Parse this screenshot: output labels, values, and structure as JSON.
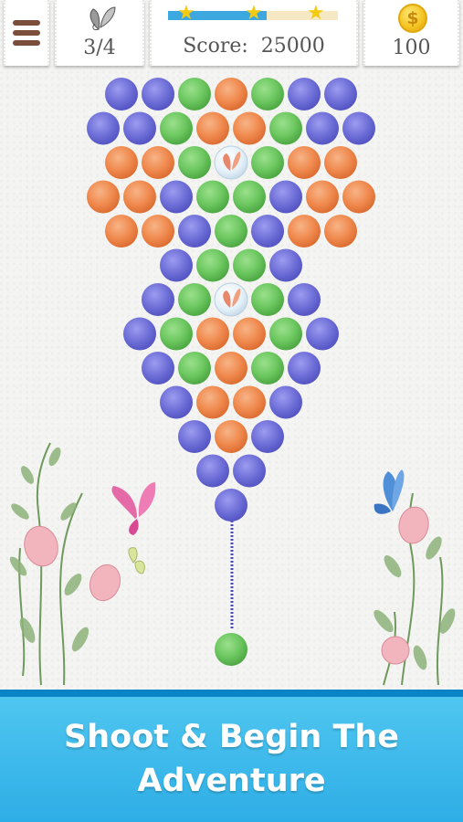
{
  "hud": {
    "menu_icon": "hamburger-menu-icon",
    "butterflies": "3/4",
    "butterfly_icon": "butterfly-icon",
    "progress": 0.58,
    "stars": 3,
    "score_label": "Score:",
    "score_value": "25000",
    "coins": "100",
    "coin_symbol": "$",
    "coin_icon": "gold-coin-icon"
  },
  "colors": {
    "blue": "#6f6fd8",
    "green": "#6cc760",
    "orange": "#f08a4f",
    "accent_blue": "#3da8e0",
    "star": "#f3cb14",
    "banner": "#2eaee6"
  },
  "board": {
    "rows": [
      "BBGOGBB",
      "BBGOOGBB",
      "OOGFGOO",
      "OOBGGBOO",
      "OOBGBOO",
      "BGGB",
      "BGFGB",
      "BGOOGB",
      "BGOGB",
      "BOOB",
      "BOB",
      "BB",
      "B"
    ],
    "legend": {
      "B": "blue",
      "G": "green",
      "O": "orange",
      "F": "trapped-butterfly"
    }
  },
  "shooter": {
    "current_bubble": "green"
  },
  "banner": {
    "line1": "Shoot & Begin The",
    "line2": "Adventure"
  }
}
